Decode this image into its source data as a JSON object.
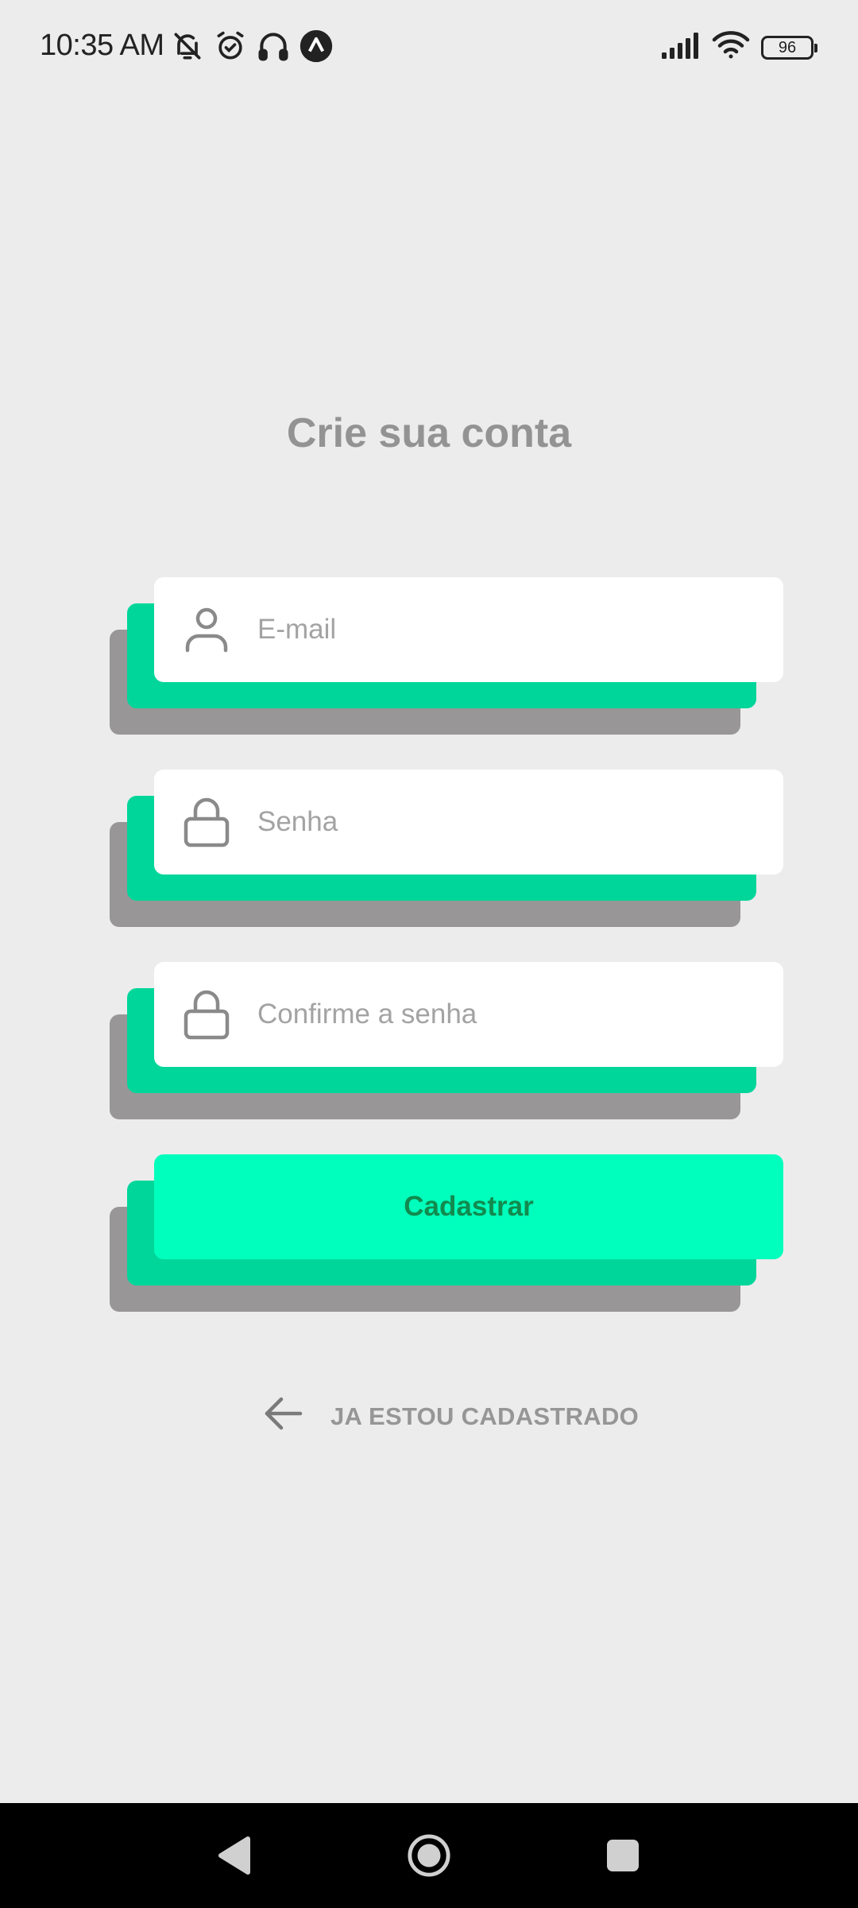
{
  "status_bar": {
    "time": "10:35 AM",
    "battery": "96",
    "left_icons": [
      "bell-muted-icon",
      "alarm-icon",
      "headphones-icon",
      "app-notification-icon"
    ],
    "right_icons": [
      "signal-icon",
      "wifi-icon",
      "battery-icon"
    ]
  },
  "page": {
    "title": "Crie sua conta"
  },
  "form": {
    "email": {
      "placeholder": "E-mail",
      "value": "",
      "icon": "user-icon"
    },
    "password": {
      "placeholder": "Senha",
      "value": "",
      "icon": "lock-icon"
    },
    "confirm_password": {
      "placeholder": "Confirme a senha",
      "value": "",
      "icon": "lock-icon"
    },
    "submit_label": "Cadastrar"
  },
  "back_link": {
    "label": "JA ESTOU CADASTRADO",
    "icon": "arrow-left-icon"
  },
  "nav_bar": {
    "buttons": [
      "back-triangle-icon",
      "home-circle-icon",
      "recents-square-icon"
    ]
  },
  "colors": {
    "background": "#ececec",
    "accent": "#00ffbc",
    "accent_dark": "#00d69a",
    "shadow_gray": "#989696",
    "text_muted": "#939393",
    "button_text": "#128a4e"
  }
}
